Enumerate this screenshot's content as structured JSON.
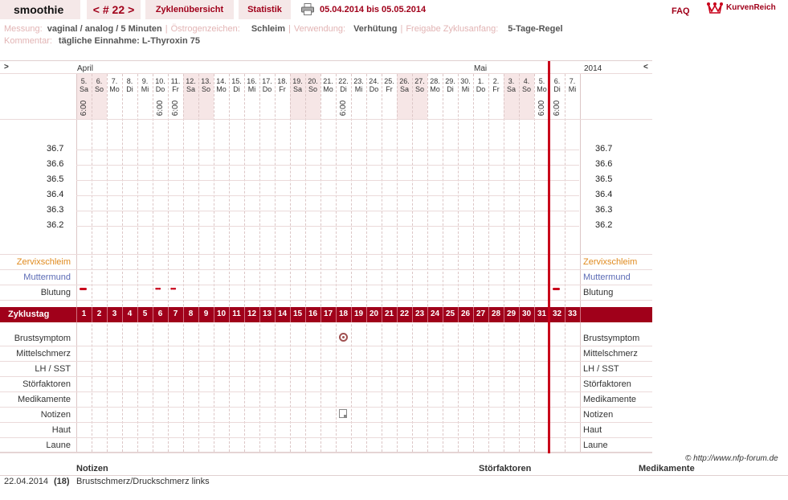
{
  "nav": {
    "title": "smoothie",
    "cycle_prev": "<",
    "cycle_label": "# 22",
    "cycle_next": ">",
    "overview": "Zyklenübersicht",
    "stats": "Statistik",
    "printer_icon": "printer-icon",
    "date_range": "05.04.2014 bis 05.05.2014",
    "faq": "FAQ",
    "brand": "KurvenReich",
    "brand_icon": "crown-icon"
  },
  "meta": {
    "messung_label": "Messung:",
    "messung_value": "vaginal / analog / 5 Minuten",
    "oestrogen_label": "Östrogenzeichen:",
    "oestrogen_value": "Schleim",
    "verwendung_label": "Verwendung:",
    "verwendung_value": "Verhütung",
    "freigabe_label": "Freigabe Zyklusanfang:",
    "freigabe_value": "5-Tage-Regel",
    "kommentar_label": "Kommentar:",
    "kommentar_value": "tägliche Einnahme: L-Thyroxin 75"
  },
  "chart": {
    "nav_left": ">",
    "nav_right": "<",
    "month_april": "April",
    "month_mai": "Mai",
    "year": "2014",
    "six_am": "6:00",
    "days": [
      {
        "d": "5.",
        "w": "Sa",
        "we": true,
        "six": true
      },
      {
        "d": "6.",
        "w": "So",
        "we": true,
        "six": false
      },
      {
        "d": "7.",
        "w": "Mo",
        "we": false,
        "six": false
      },
      {
        "d": "8.",
        "w": "Di",
        "we": false,
        "six": false
      },
      {
        "d": "9.",
        "w": "Mi",
        "we": false,
        "six": false
      },
      {
        "d": "10.",
        "w": "Do",
        "we": false,
        "six": true
      },
      {
        "d": "11.",
        "w": "Fr",
        "we": false,
        "six": true
      },
      {
        "d": "12.",
        "w": "Sa",
        "we": true,
        "six": false
      },
      {
        "d": "13.",
        "w": "So",
        "we": true,
        "six": false
      },
      {
        "d": "14.",
        "w": "Mo",
        "we": false,
        "six": false
      },
      {
        "d": "15.",
        "w": "Di",
        "we": false,
        "six": false
      },
      {
        "d": "16.",
        "w": "Mi",
        "we": false,
        "six": false
      },
      {
        "d": "17.",
        "w": "Do",
        "we": false,
        "six": false
      },
      {
        "d": "18.",
        "w": "Fr",
        "we": false,
        "six": false
      },
      {
        "d": "19.",
        "w": "Sa",
        "we": true,
        "six": false
      },
      {
        "d": "20.",
        "w": "So",
        "we": true,
        "six": false
      },
      {
        "d": "21.",
        "w": "Mo",
        "we": false,
        "six": false
      },
      {
        "d": "22.",
        "w": "Di",
        "we": false,
        "six": true
      },
      {
        "d": "23.",
        "w": "Mi",
        "we": false,
        "six": false
      },
      {
        "d": "24.",
        "w": "Do",
        "we": false,
        "six": false
      },
      {
        "d": "25.",
        "w": "Fr",
        "we": false,
        "six": false
      },
      {
        "d": "26.",
        "w": "Sa",
        "we": true,
        "six": false
      },
      {
        "d": "27.",
        "w": "So",
        "we": true,
        "six": false
      },
      {
        "d": "28.",
        "w": "Mo",
        "we": false,
        "six": false
      },
      {
        "d": "29.",
        "w": "Di",
        "we": false,
        "six": false
      },
      {
        "d": "30.",
        "w": "Mi",
        "we": false,
        "six": false
      },
      {
        "d": "1.",
        "w": "Do",
        "we": false,
        "six": false
      },
      {
        "d": "2.",
        "w": "Fr",
        "we": false,
        "six": false
      },
      {
        "d": "3.",
        "w": "Sa",
        "we": true,
        "six": false
      },
      {
        "d": "4.",
        "w": "So",
        "we": true,
        "six": false
      },
      {
        "d": "5.",
        "w": "Mo",
        "we": false,
        "six": true
      },
      {
        "d": "6.",
        "w": "Di",
        "we": false,
        "six": true
      },
      {
        "d": "7.",
        "w": "Mi",
        "we": false,
        "six": false
      }
    ],
    "temps": [
      "36.7",
      "36.6",
      "36.5",
      "36.4",
      "36.3",
      "36.2"
    ],
    "row_cervix": "Zervixschleim",
    "row_muttermund": "Muttermund",
    "row_blutung": "Blutung",
    "cycle_label": "Zyklustag",
    "cycle_days": [
      "1",
      "2",
      "3",
      "4",
      "5",
      "6",
      "7",
      "8",
      "9",
      "10",
      "11",
      "12",
      "13",
      "14",
      "15",
      "16",
      "17",
      "18",
      "19",
      "20",
      "21",
      "22",
      "23",
      "24",
      "25",
      "26",
      "27",
      "28",
      "29",
      "30",
      "31",
      "32",
      "33"
    ],
    "bleeding": [
      {
        "day": 1,
        "kind": "bar"
      },
      {
        "day": 6,
        "kind": "dots"
      },
      {
        "day": 7,
        "kind": "dots"
      },
      {
        "day": 32,
        "kind": "bar"
      }
    ],
    "symptom_rows": [
      "Brustsymptom",
      "Mittelschmerz",
      "LH / SST",
      "Störfaktoren",
      "Medikamente",
      "Notizen",
      "Haut",
      "Laune"
    ],
    "symptom_breast_day": 18,
    "note_day": 18,
    "today_day": 32,
    "colors": {
      "accent": "#a0001a",
      "today": "#c8001a",
      "weekend": "#f6e6e6"
    }
  },
  "copyright": "© http://www.nfp-forum.de",
  "notes": {
    "h_notizen": "Notizen",
    "h_stoer": "Störfaktoren",
    "h_medi": "Medikamente",
    "rows": [
      {
        "date": "22.04.2014",
        "day": "(18)",
        "text": "Brustschmerz/Druckschmerz links"
      }
    ]
  }
}
